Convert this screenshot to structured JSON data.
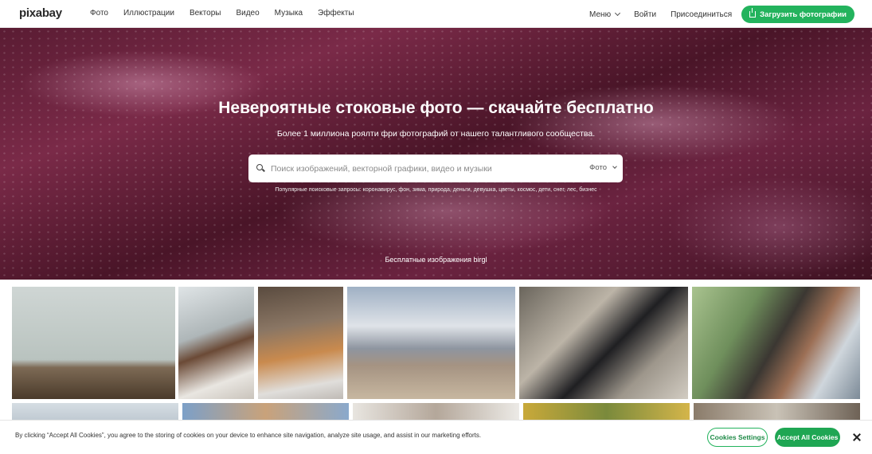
{
  "header": {
    "logo": "pixabay",
    "nav": [
      "Фото",
      "Иллюстрации",
      "Векторы",
      "Видео",
      "Музыка",
      "Эффекты"
    ],
    "menu_label": "Меню",
    "login_label": "Войти",
    "join_label": "Присоединиться",
    "upload_label": "Загрузить фотографии"
  },
  "hero": {
    "title": "Невероятные стоковые фото — скачайте бесплатно",
    "subtitle": "Более 1 миллиона роялти фри фотографий от нашего талантливого сообщества.",
    "search_placeholder": "Поиск изображений, векторной графики, видео и музыки",
    "search_type": "Фото",
    "popular": "Популярные поисковые запросы: коронавирус, фон, зима, природа, деньги, девушка, цветы, космос, дети, снег, лес, бизнес",
    "credit": "Бесплатные изображения birgl"
  },
  "gallery": {
    "row1": [
      "bird",
      "woman-sweater",
      "cat",
      "house",
      "snake",
      "couple"
    ],
    "row2": [
      "sky",
      "branches",
      "animal",
      "plant",
      "tree"
    ]
  },
  "cookie": {
    "text": "By clicking “Accept All Cookies”, you agree to the storing of cookies on your device to enhance site navigation, analyze site usage, and assist in our marketing efforts.",
    "settings_label": "Cookies Settings",
    "accept_label": "Accept All Cookies"
  },
  "colors": {
    "accent": "#23b35d",
    "hero_base": "#5a1c33"
  }
}
